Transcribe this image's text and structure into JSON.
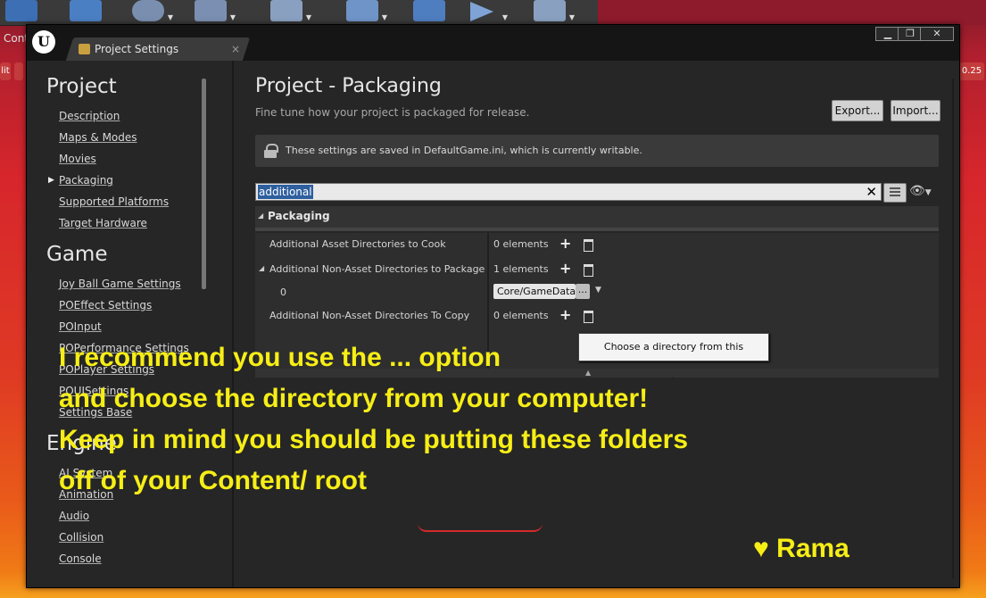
{
  "toolbar": {
    "first_label": "Cont",
    "buttons": [
      {
        "name": "content-button",
        "icon": "grid-icon",
        "color": "#3d6fb5"
      },
      {
        "name": "marketplace-button",
        "icon": "document-icon",
        "color": "#4b7fc4"
      },
      {
        "name": "settings-button",
        "icon": "gear-icon",
        "color": "#7a8fb0"
      },
      {
        "name": "blueprints-button",
        "icon": "gamepad-icon",
        "color": "#7b8fb3"
      },
      {
        "name": "cinematics-button",
        "icon": "clapper-icon",
        "color": "#8aa0c0"
      },
      {
        "name": "build-button",
        "icon": "build-icon",
        "color": "#6f94c7"
      },
      {
        "name": "compile-button",
        "icon": "cubes-icon",
        "color": "#4f7ec0"
      },
      {
        "name": "play-button",
        "icon": "play-icon",
        "color": "#7fa3d6"
      },
      {
        "name": "launch-button",
        "icon": "launch-icon",
        "color": "#8aa0c0"
      }
    ]
  },
  "peek": {
    "left_text": "lit",
    "right_text": "0.25"
  },
  "window": {
    "tab_label": "Project Settings",
    "tab_close": "×",
    "min": "▁",
    "max": "❐",
    "close": "✕"
  },
  "nav": {
    "sections": [
      {
        "title": "Project",
        "items": [
          "Description",
          "Maps & Modes",
          "Movies",
          "Packaging",
          "Supported Platforms",
          "Target Hardware"
        ]
      },
      {
        "title": "Game",
        "items": [
          "Joy Ball Game Settings",
          "POEffect Settings",
          "POInput",
          "POPerformance Settings",
          "POPlayer Settings",
          "POUISettings",
          "Settings Base"
        ]
      },
      {
        "title": "Engine",
        "items": [
          "AI System",
          "Animation",
          "Audio",
          "Collision",
          "Console"
        ]
      }
    ],
    "selected": "Packaging"
  },
  "main": {
    "title": "Project - Packaging",
    "subtitle": "Fine tune how your project is packaged for release.",
    "export_label": "Export...",
    "import_label": "Import...",
    "notice": "These settings are saved in DefaultGame.ini, which is currently writable.",
    "search_value": "additional",
    "category": "Packaging",
    "rows": [
      {
        "label": "Additional Asset Directories to Cook",
        "value": "0 elements"
      },
      {
        "label": "Additional Non-Asset Directories to Package",
        "value": "1 elements"
      },
      {
        "label": "0",
        "value": "Core/GameData"
      },
      {
        "label": "Additional Non-Asset Directories To Copy",
        "value": "0 elements"
      }
    ],
    "dots_label": "...",
    "tooltip": "Choose a directory from this computer"
  },
  "overlay": {
    "lines": [
      "I recommend you use the ... option",
      "and choose the directory from your computer!",
      "Keep in mind you should be putting these folders"
    ],
    "line4_prefix": "off of your ",
    "line4_word": "Content/",
    "line4_suffix": " root",
    "signature": "♥ Rama",
    "color": "#f6ee16"
  }
}
